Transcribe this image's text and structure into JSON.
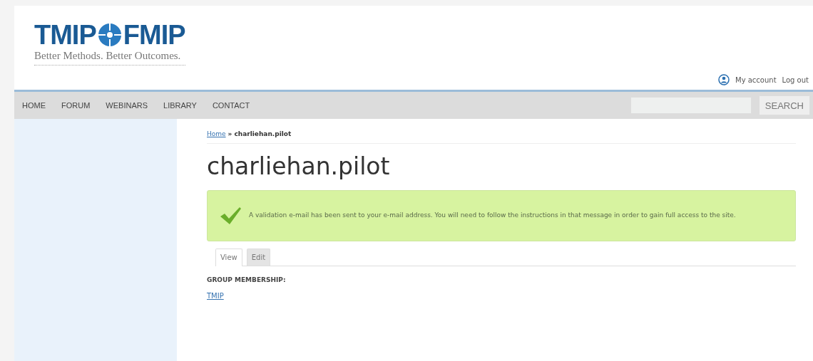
{
  "logo": {
    "left": "TMIP",
    "right": "FMIP",
    "tagline": "Better Methods. Better Outcomes."
  },
  "user_links": [
    "My account",
    "Log out"
  ],
  "nav": [
    {
      "label": "HOME"
    },
    {
      "label": "FORUM"
    },
    {
      "label": "WEBINARS"
    },
    {
      "label": "LIBRARY"
    },
    {
      "label": "CONTACT"
    }
  ],
  "search": {
    "button": "SEARCH"
  },
  "breadcrumb": {
    "link": "Home",
    "separator": "»",
    "current": "charliehan.pilot"
  },
  "title": "charliehan.pilot",
  "message": "A validation e-mail has been sent to your e-mail address. You will need to follow the instructions in that message in order to gain full access to the site.",
  "tabs": [
    {
      "label": "View",
      "selected": true
    },
    {
      "label": "Edit",
      "selected": false
    }
  ],
  "group": {
    "heading": "GROUP MEMBERSHIP:",
    "link": "TMIP"
  }
}
